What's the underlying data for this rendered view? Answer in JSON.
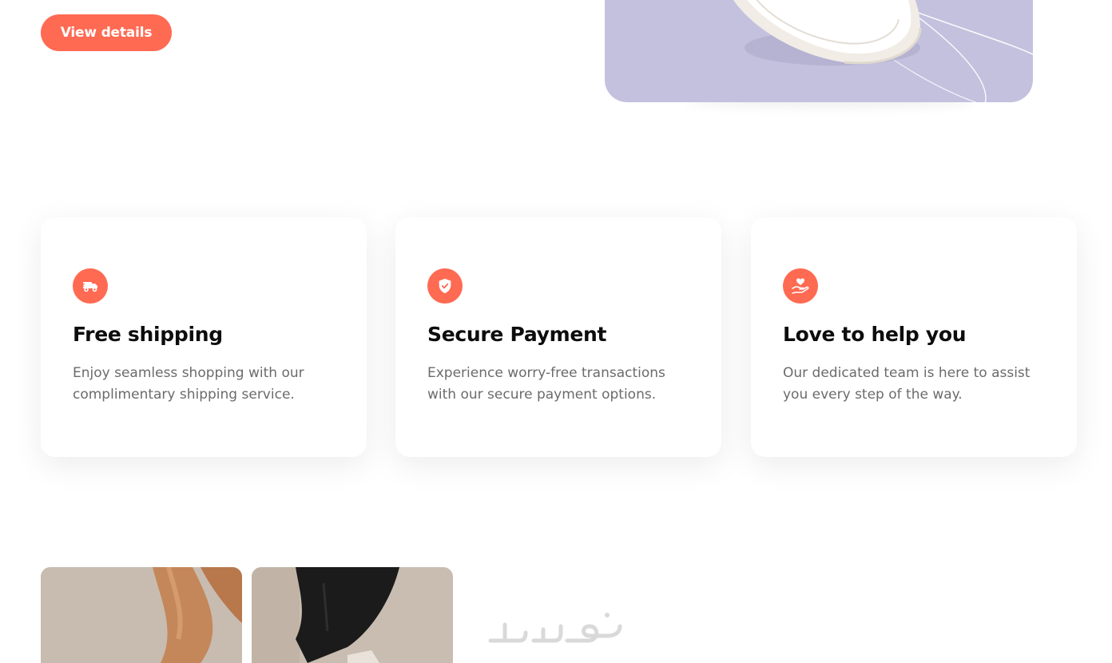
{
  "hero": {
    "view_details_label": "View details"
  },
  "features": [
    {
      "icon": "truck-icon",
      "title": "Free shipping",
      "description": "Enjoy seamless shopping with our complimentary shipping service."
    },
    {
      "icon": "shield-check-icon",
      "title": "Secure Payment",
      "description": "Experience worry-free transactions with our secure payment options."
    },
    {
      "icon": "hand-heart-icon",
      "title": "Love to help you",
      "description": "Our dedicated team is here to assist you every step of the way."
    }
  ],
  "colors": {
    "accent": "#ff6a52",
    "hero_bg": "#c3c1de",
    "text_dark": "#0d0d0d",
    "text_muted": "#6b6b6b"
  },
  "watermark": {
    "text": "خمسات"
  }
}
